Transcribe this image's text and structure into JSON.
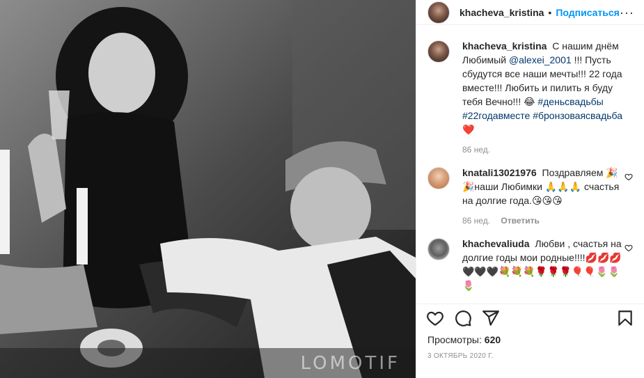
{
  "post": {
    "media_watermark": "LOMOTIF"
  },
  "header": {
    "username": "khacheva_kristina",
    "separator": "•",
    "follow_label": "Подписаться",
    "more_label": "···"
  },
  "caption": {
    "username": "khacheva_kristina",
    "text_part1": "С нашим днём Любимый",
    "mention": "@alexei_2001",
    "text_part2": "!!! Пусть сбудутся все наши мечты!!! 22 года вместе!!! Любить и пилить я буду тебя Вечно!!! 😂",
    "tag1": "#деньсвадьбы",
    "tag2": "#22годавместе",
    "tag3": "#бронзоваясвадьба",
    "trailing_emoji": "❤️",
    "time": "86 нед."
  },
  "comments": [
    {
      "username": "knatali13021976",
      "text": "Поздравляем 🎉🎉наши Любимки 🙏🙏🙏 счастья на долгие года.😘😘😘",
      "time": "86 нед.",
      "reply_label": "Ответить"
    },
    {
      "username": "khachevaliuda",
      "text": "Любви , счастья на долгие годы мои родные!!!!💋💋💋🖤🖤🖤💐💐💐🌹🌹🌹🎈🎈🌷🌷🌷"
    }
  ],
  "stats": {
    "views_label": "Просмотры:",
    "views_count": "620",
    "date": "3 ОКТЯБРЬ 2020 Г."
  },
  "icons": {
    "like": "heart-icon",
    "comment": "comment-icon",
    "share": "share-icon",
    "save": "bookmark-icon"
  },
  "colors": {
    "accent": "#0095f6",
    "link": "#00376b",
    "muted": "#8e8e8e",
    "text": "#262626"
  }
}
